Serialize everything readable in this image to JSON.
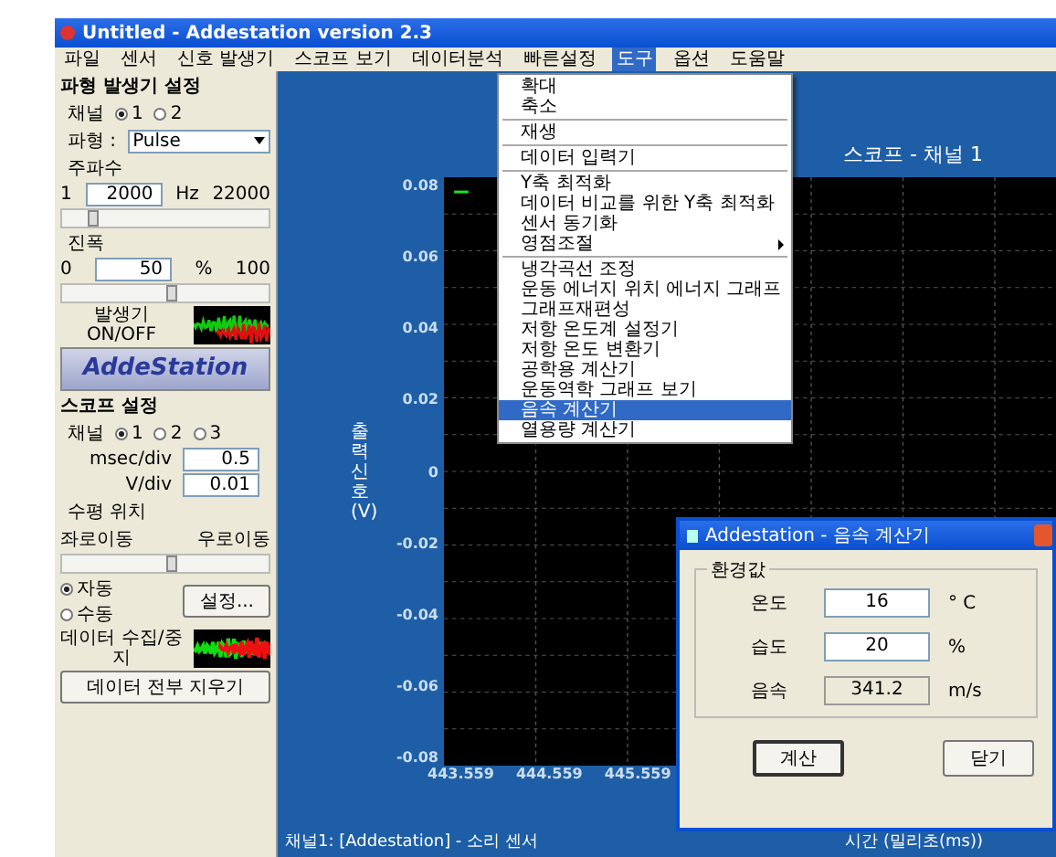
{
  "window": {
    "title": "Untitled - Addestation version 2.3"
  },
  "menubar": [
    {
      "label": "파일",
      "selected": false
    },
    {
      "label": "센서",
      "selected": false
    },
    {
      "label": "신호 발생기",
      "selected": false
    },
    {
      "label": "스코프 보기",
      "selected": false
    },
    {
      "label": "데이터분석",
      "selected": false
    },
    {
      "label": "빠른설정",
      "selected": false
    },
    {
      "label": "도구",
      "selected": true
    },
    {
      "label": "옵션",
      "selected": false
    },
    {
      "label": "도움말",
      "selected": false
    }
  ],
  "generator": {
    "title": "파형 발생기 설정",
    "channel_label": "채널",
    "channels": [
      {
        "label": "1",
        "selected": true
      },
      {
        "label": "2",
        "selected": false
      }
    ],
    "waveform_label": "파형 :",
    "waveform": "Pulse",
    "frequency": {
      "label": "주파수",
      "min": "1",
      "value": "2000",
      "unit": "Hz",
      "max": "22000",
      "level": 0.09
    },
    "amplitude": {
      "label": "진폭",
      "min": "0",
      "value": "50",
      "unit": "%",
      "max": "100",
      "level": 0.5
    },
    "toggle_label": "발생기 ON/OFF"
  },
  "logo": {
    "text": "AddeStation"
  },
  "scope": {
    "title": "스코프 설정",
    "channel_label": "채널",
    "channels": [
      {
        "label": "1",
        "selected": true
      },
      {
        "label": "2",
        "selected": false
      },
      {
        "label": "3",
        "selected": false
      }
    ],
    "rows": [
      {
        "label": "msec/div",
        "value": "0.5"
      },
      {
        "label": "V/div",
        "value": "0.01"
      }
    ],
    "position": {
      "label": "수평 위치",
      "left": "좌로이동",
      "right": "우로이동",
      "level": 0.5
    },
    "modes": [
      {
        "label": "자동",
        "selected": true
      },
      {
        "label": "수동",
        "selected": false
      }
    ],
    "settings_button": "설정...",
    "collect_label": "데이터 수집/중지",
    "clear_button": "데이터 전부 지우기"
  },
  "plot": {
    "title": "스코프 - 채널 1",
    "y_label": "출력 신호 (V)",
    "y_ticks": [
      "0.08",
      "0.06",
      "0.04",
      "0.02",
      "0",
      "-0.02",
      "-0.04",
      "-0.06",
      "-0.08"
    ],
    "x_ticks": [
      "443.559",
      "444.559",
      "445.559"
    ],
    "x_label": "시간 (밀리초(ms))"
  },
  "menu": [
    {
      "kind": "item",
      "label": "확대",
      "selected": false
    },
    {
      "kind": "item",
      "label": "축소",
      "selected": false
    },
    {
      "kind": "separator"
    },
    {
      "kind": "item",
      "label": "재생",
      "selected": false
    },
    {
      "kind": "separator"
    },
    {
      "kind": "item",
      "label": "데이터 입력기",
      "selected": false
    },
    {
      "kind": "separator"
    },
    {
      "kind": "item",
      "label": "Y축 최적화",
      "selected": false
    },
    {
      "kind": "item",
      "label": "데이터 비교를 위한 Y축 최적화",
      "selected": false
    },
    {
      "kind": "item",
      "label": "센서 동기화",
      "selected": false
    },
    {
      "kind": "submenu",
      "label": "영점조절",
      "selected": false
    },
    {
      "kind": "separator"
    },
    {
      "kind": "item",
      "label": "냉각곡선 조정",
      "selected": false
    },
    {
      "kind": "item",
      "label": "운동 에너지 위치 에너지 그래프",
      "selected": false
    },
    {
      "kind": "item",
      "label": "그래프재편성",
      "selected": false
    },
    {
      "kind": "item",
      "label": "저항 온도계 설정기",
      "selected": false
    },
    {
      "kind": "item",
      "label": "저항 온도 변환기",
      "selected": false
    },
    {
      "kind": "item",
      "label": "공학용 계산기",
      "selected": false
    },
    {
      "kind": "item",
      "label": "운동역학 그래프 보기",
      "selected": false
    },
    {
      "kind": "item",
      "label": "음속 계산기",
      "selected": true
    },
    {
      "kind": "item",
      "label": "열용량 계산기",
      "selected": false
    }
  ],
  "dialog": {
    "title": "Addestation - 음속 계산기",
    "group": "환경값",
    "fields": [
      {
        "kind": "input",
        "label": "온도",
        "value": "16",
        "unit": "° C"
      },
      {
        "kind": "input",
        "label": "습도",
        "value": "20",
        "unit": "%"
      },
      {
        "kind": "readonly",
        "label": "음속",
        "value": "341.2",
        "unit": "m/s"
      }
    ],
    "buttons": [
      {
        "label": "계산",
        "default": true
      },
      {
        "label": "닫기",
        "default": false
      }
    ]
  },
  "status_bar": {
    "text": "채널1: [Addestation] - 소리 센서"
  }
}
